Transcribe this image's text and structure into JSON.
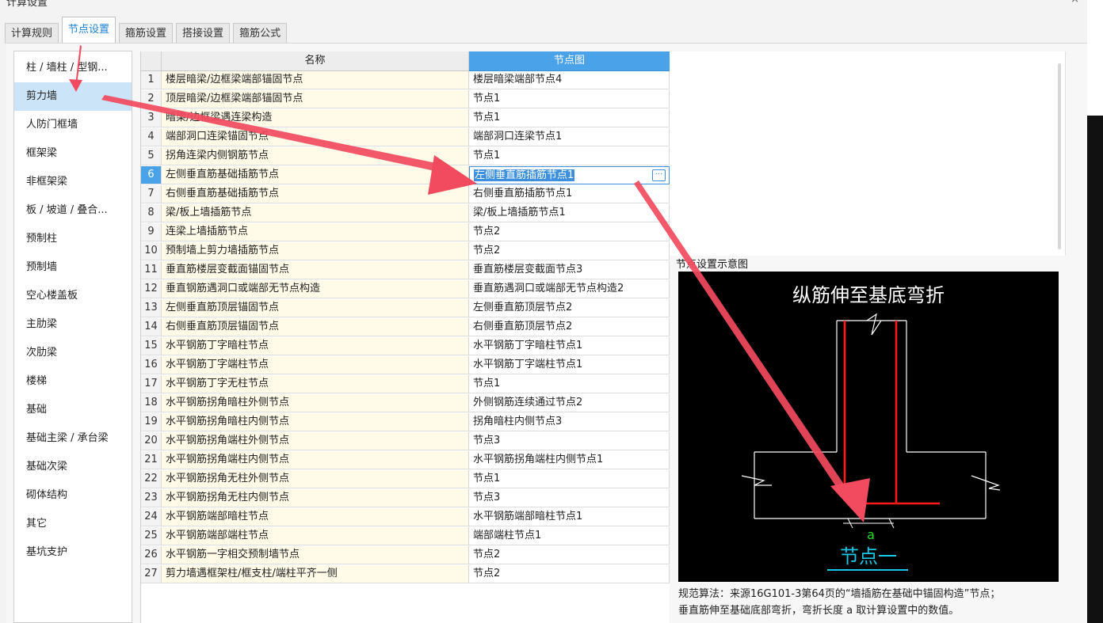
{
  "window": {
    "title": "计算设置",
    "controls": "— ×"
  },
  "tabs": [
    {
      "label": "计算规则",
      "active": false
    },
    {
      "label": "节点设置",
      "active": true
    },
    {
      "label": "箍筋设置",
      "active": false
    },
    {
      "label": "搭接设置",
      "active": false
    },
    {
      "label": "箍筋公式",
      "active": false
    }
  ],
  "categories": [
    "柱 / 墙柱 / 型钢...",
    "剪力墙",
    "人防门框墙",
    "框架梁",
    "非框架梁",
    "板 / 坡道 / 叠合...",
    "预制柱",
    "预制墙",
    "空心楼盖板",
    "主肋梁",
    "次肋梁",
    "楼梯",
    "基础",
    "基础主梁 / 承台梁",
    "基础次梁",
    "砌体结构",
    "其它",
    "基坑支护"
  ],
  "selected_category": "剪力墙",
  "grid": {
    "headers": {
      "name": "名称",
      "node": "节点图"
    },
    "selected_row": "6",
    "rows": [
      {
        "num": "1",
        "name": "楼层暗梁/边框梁端部锚固节点",
        "node": "楼层暗梁端部节点4"
      },
      {
        "num": "2",
        "name": "顶层暗梁/边框梁端部锚固节点",
        "node": "节点1"
      },
      {
        "num": "3",
        "name": "暗梁/边框梁遇连梁构造",
        "node": "节点1"
      },
      {
        "num": "4",
        "name": "端部洞口连梁锚固节点",
        "node": "端部洞口连梁节点1"
      },
      {
        "num": "5",
        "name": "拐角连梁内侧钢筋节点",
        "node": "节点1"
      },
      {
        "num": "6",
        "name": "左侧垂直筋基础插筋节点",
        "node": "左侧垂直筋插筋节点1"
      },
      {
        "num": "7",
        "name": "右侧垂直筋基础插筋节点",
        "node": "右侧垂直筋插筋节点1"
      },
      {
        "num": "8",
        "name": "梁/板上墙插筋节点",
        "node": "梁/板上墙插筋节点1"
      },
      {
        "num": "9",
        "name": "连梁上墙插筋节点",
        "node": "节点2"
      },
      {
        "num": "10",
        "name": "预制墙上剪力墙插筋节点",
        "node": "节点2"
      },
      {
        "num": "11",
        "name": "垂直筋楼层变截面锚固节点",
        "node": "垂直筋楼层变截面节点3"
      },
      {
        "num": "12",
        "name": "垂直钢筋遇洞口或端部无节点构造",
        "node": "垂直筋遇洞口或端部无节点构造2"
      },
      {
        "num": "13",
        "name": "左侧垂直筋顶层锚固节点",
        "node": "左侧垂直筋顶层节点2"
      },
      {
        "num": "14",
        "name": "右侧垂直筋顶层锚固节点",
        "node": "右侧垂直筋顶层节点2"
      },
      {
        "num": "15",
        "name": "水平钢筋丁字暗柱节点",
        "node": "水平钢筋丁字暗柱节点1"
      },
      {
        "num": "16",
        "name": "水平钢筋丁字端柱节点",
        "node": "水平钢筋丁字端柱节点1"
      },
      {
        "num": "17",
        "name": "水平钢筋丁字无柱节点",
        "node": "节点1"
      },
      {
        "num": "18",
        "name": "水平钢筋拐角暗柱外侧节点",
        "node": "外侧钢筋连续通过节点2"
      },
      {
        "num": "19",
        "name": "水平钢筋拐角暗柱内侧节点",
        "node": "拐角暗柱内侧节点3"
      },
      {
        "num": "20",
        "name": "水平钢筋拐角端柱外侧节点",
        "node": "节点3"
      },
      {
        "num": "21",
        "name": "水平钢筋拐角端柱内侧节点",
        "node": "水平钢筋拐角端柱内侧节点1"
      },
      {
        "num": "22",
        "name": "水平钢筋拐角无柱外侧节点",
        "node": "节点1"
      },
      {
        "num": "23",
        "name": "水平钢筋拐角无柱内侧节点",
        "node": "节点3"
      },
      {
        "num": "24",
        "name": "水平钢筋端部暗柱节点",
        "node": "水平钢筋端部暗柱节点1"
      },
      {
        "num": "25",
        "name": "水平钢筋端部端柱节点",
        "node": "端部端柱节点1"
      },
      {
        "num": "26",
        "name": "水平钢筋一字相交预制墙节点",
        "node": "节点2"
      },
      {
        "num": "27",
        "name": "剪力墙遇框架柱/框支柱/端柱平齐一侧",
        "node": "节点2"
      }
    ]
  },
  "diagram": {
    "panel_title": "节点设置示意图",
    "heading": "纵筋伸至基底弯折",
    "dim_label": "a",
    "node_label": "节点一",
    "colors": {
      "rebar": "#ff1a1a",
      "line": "#ffffff",
      "dim": "#22dd22",
      "label": "#19c7e6"
    }
  },
  "description": [
    "规范算法：来源16G101-3第64页的“墙插筋在基础中锚固构造”节点；",
    "垂直筋伸至基础底部弯折，弯折长度 a 取计算设置中的数值。"
  ],
  "annotation_color": "#f24a5e"
}
